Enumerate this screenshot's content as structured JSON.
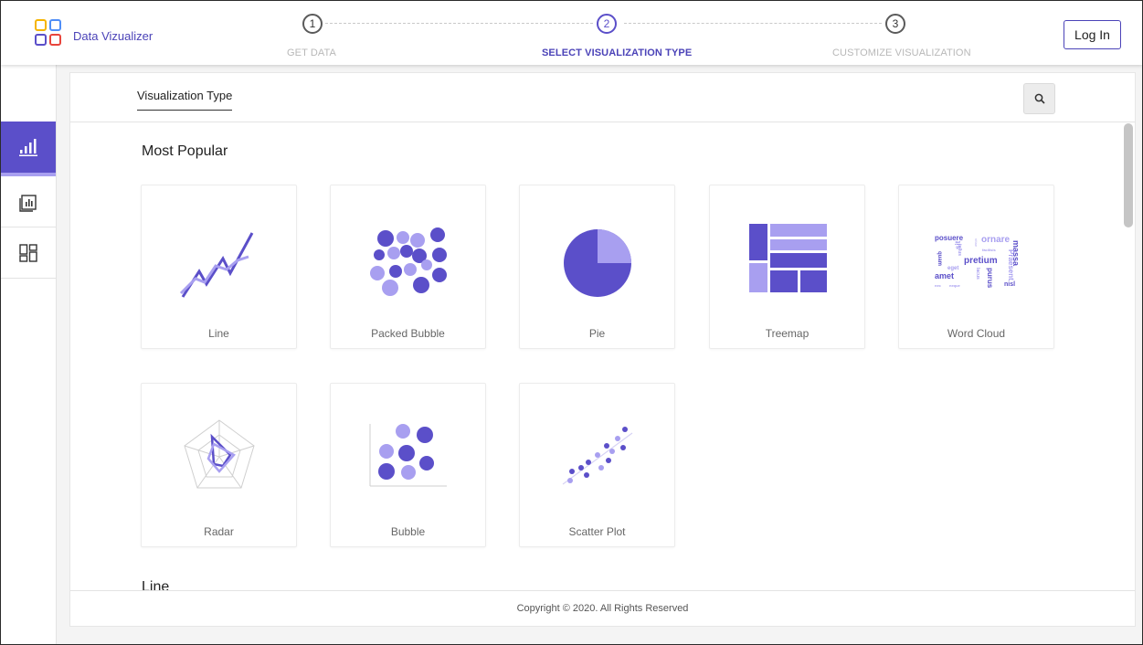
{
  "app": {
    "brand": "Data Vizualizer",
    "logo_colors": [
      "#f5b400",
      "#4f8ef7",
      "#5b4fc9",
      "#e8453c"
    ]
  },
  "steps": [
    {
      "number": "1",
      "label": "GET DATA",
      "active": false
    },
    {
      "number": "2",
      "label": "SELECT VISUALIZATION TYPE",
      "active": true
    },
    {
      "number": "3",
      "label": "CUSTOMIZE VISUALIZATION",
      "active": false
    }
  ],
  "header": {
    "login_label": "Log In"
  },
  "sidebar": {
    "items": [
      {
        "icon": "bar-chart-icon",
        "active": true
      },
      {
        "icon": "report-icon",
        "active": false
      },
      {
        "icon": "dashboard-icon",
        "active": false
      }
    ]
  },
  "main": {
    "tab_label": "Visualization Type",
    "search_icon": "search-icon",
    "section_title": "Most Popular",
    "next_section_title": "Line",
    "cards": [
      {
        "label": "Line",
        "icon": "line-chart-icon"
      },
      {
        "label": "Packed Bubble",
        "icon": "packed-bubble-icon"
      },
      {
        "label": "Pie",
        "icon": "pie-chart-icon"
      },
      {
        "label": "Treemap",
        "icon": "treemap-icon"
      },
      {
        "label": "Word Cloud",
        "icon": "word-cloud-icon"
      },
      {
        "label": "Radar",
        "icon": "radar-chart-icon"
      },
      {
        "label": "Bubble",
        "icon": "bubble-chart-icon"
      },
      {
        "label": "Scatter Plot",
        "icon": "scatter-plot-icon"
      }
    ],
    "word_cloud_words": [
      "posuere",
      "ornare",
      "vitae",
      "sit",
      "facilisis",
      "massa",
      "tellus",
      "pretium",
      "quam",
      "Praesent",
      "eget",
      "amet",
      "lacus",
      "purus",
      "nisl",
      "nec",
      "neque"
    ]
  },
  "footer": {
    "copyright": "Copyright © 2020. All Rights Reserved"
  },
  "colors": {
    "accent": "#5b4fc9",
    "accent_light": "#a89ff0",
    "border": "#e4e4e4"
  }
}
